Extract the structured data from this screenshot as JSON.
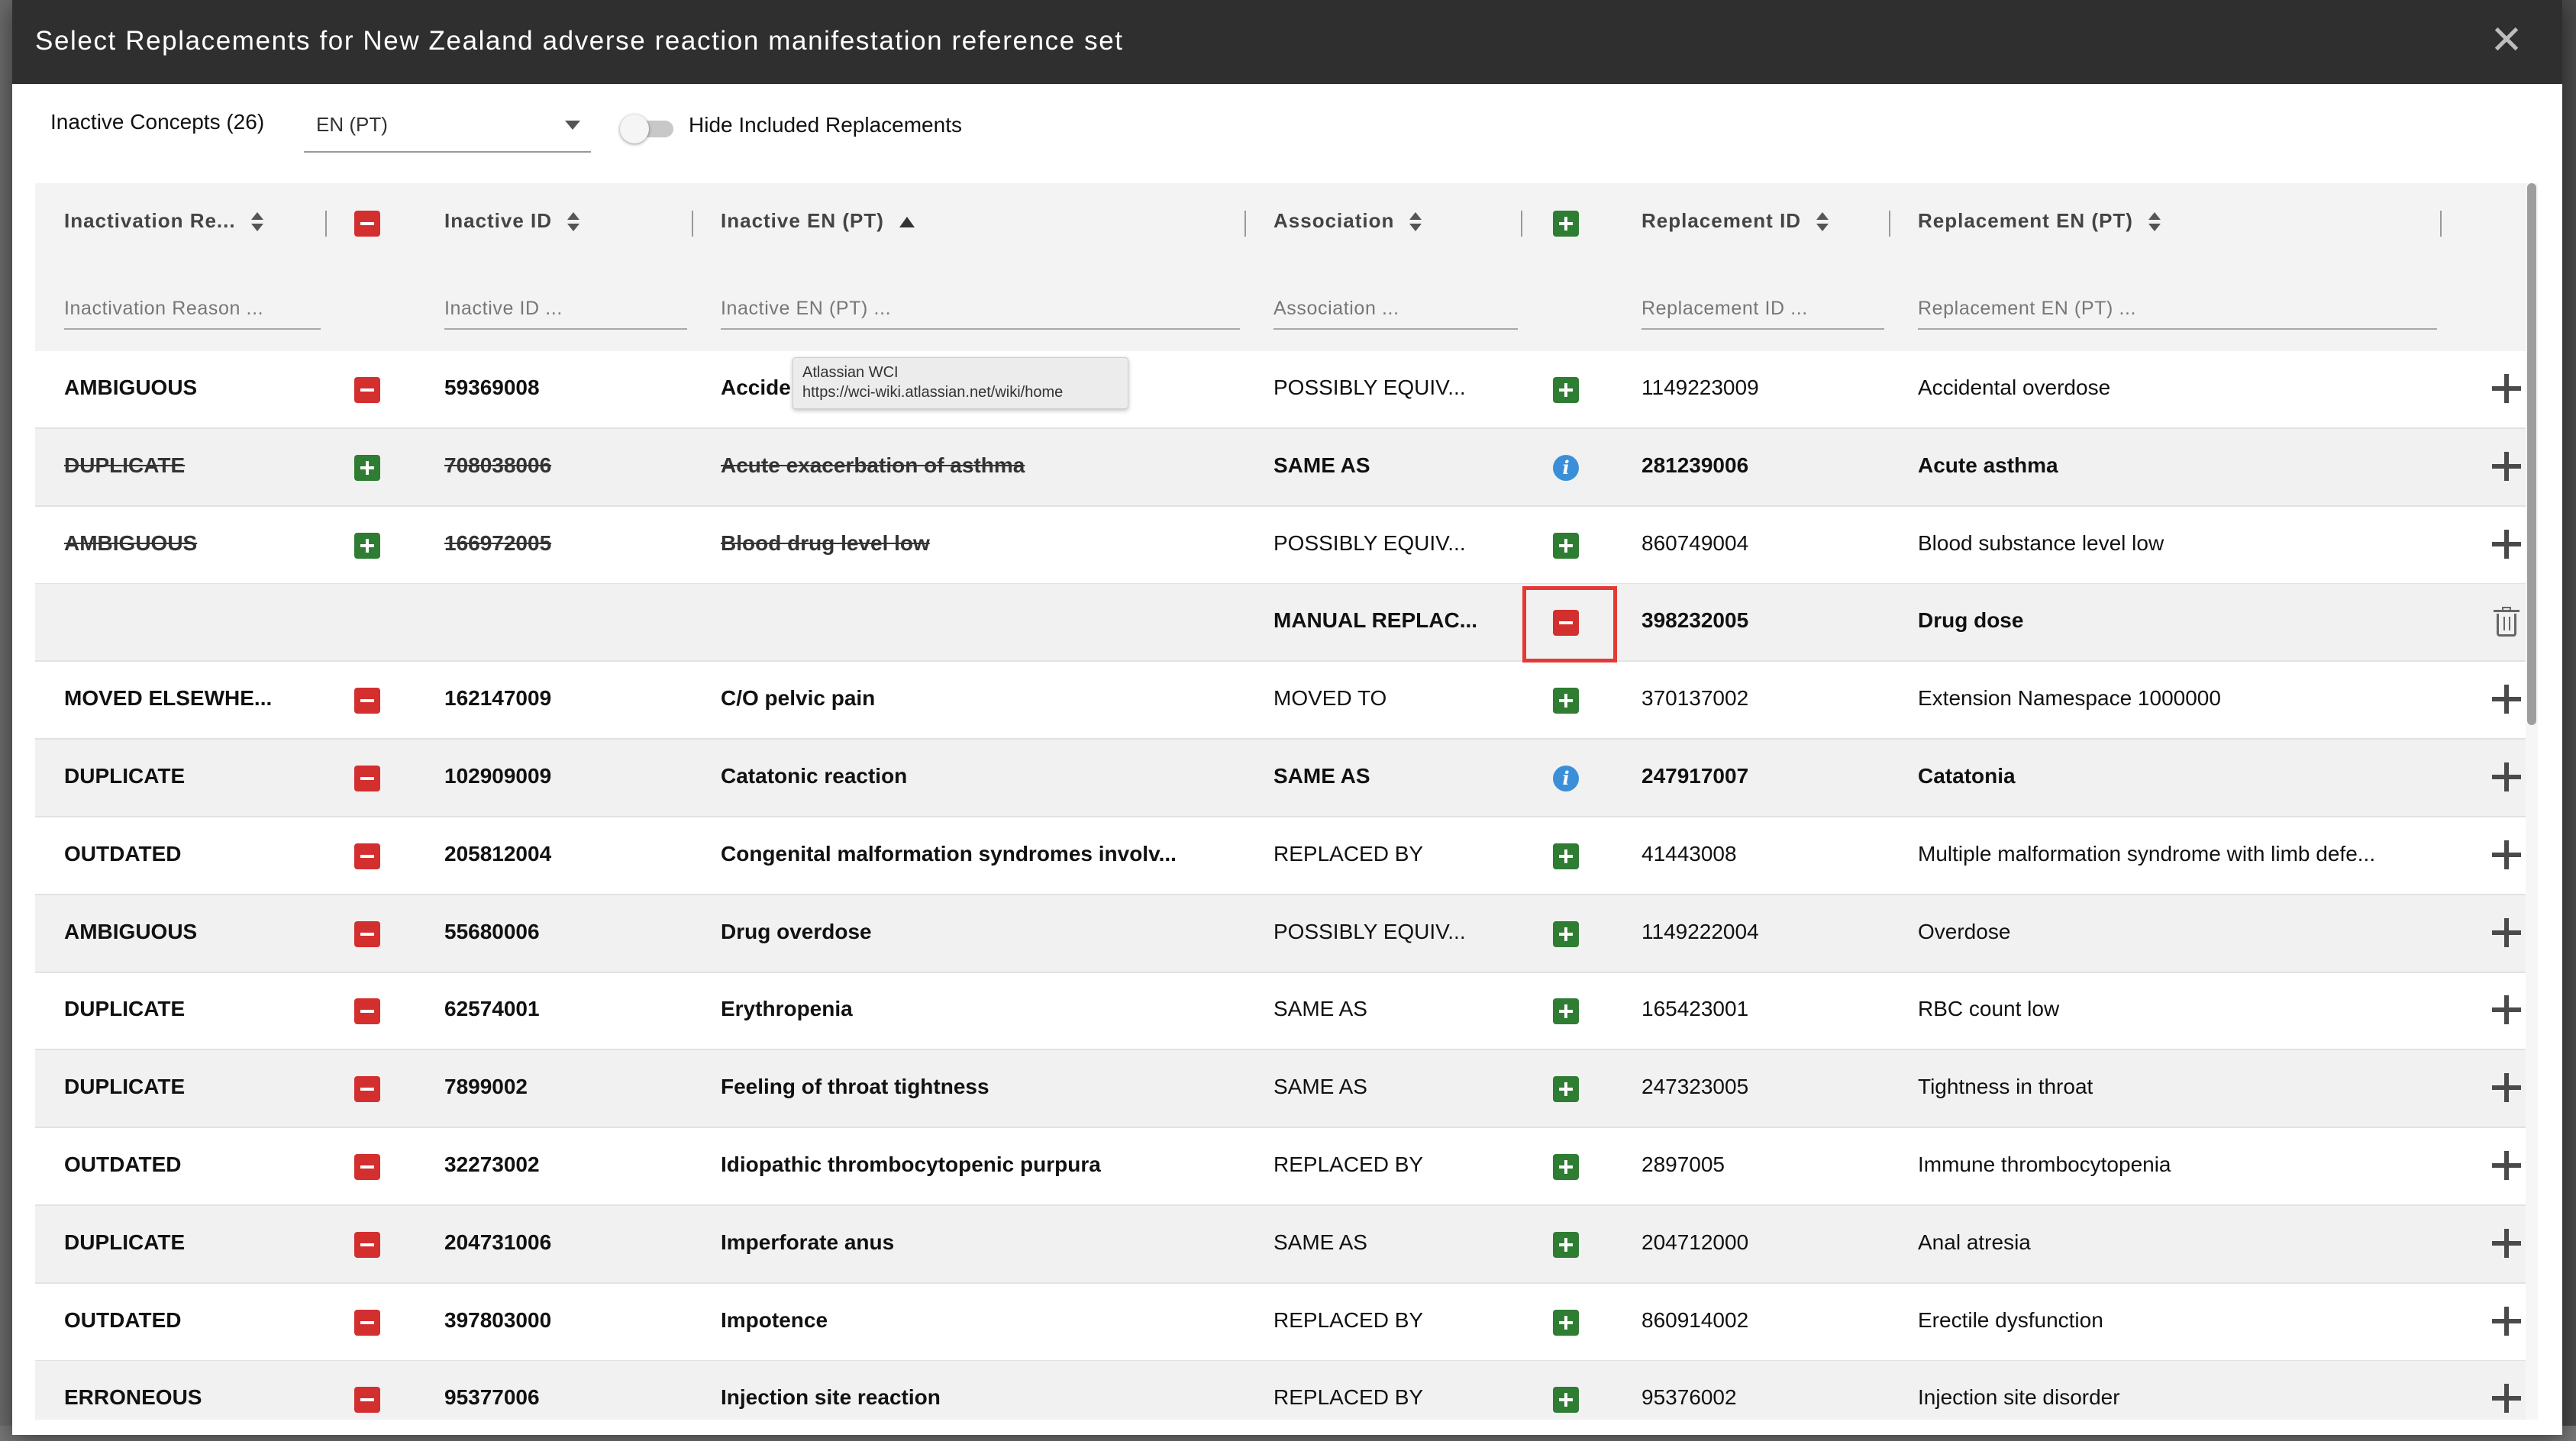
{
  "modal": {
    "title": "Select Replacements for New Zealand adverse reaction manifestation reference set",
    "close_glyph": "✕"
  },
  "toolbar": {
    "inactive_count": "Inactive Concepts (26)",
    "language": "EN (PT)",
    "toggle_label": "Hide Included Replacements",
    "toggle_on": false
  },
  "columns": {
    "reason": "Inactivation Re...",
    "inactive_id": "Inactive ID",
    "inactive_en": "Inactive EN (PT)",
    "association": "Association",
    "replacement_id": "Replacement ID",
    "replacement_en": "Replacement EN (PT)"
  },
  "filters": {
    "reason": "Inactivation Reason ...",
    "inactive_id": "Inactive ID ...",
    "inactive_en": "Inactive EN (PT) ...",
    "association": "Association ...",
    "replacement_id": "Replacement ID ...",
    "replacement_en": "Replacement EN (PT) ..."
  },
  "rows": [
    {
      "reason": "AMBIGUOUS",
      "inactive_id": "59369008",
      "inactive_en": "Accide",
      "association": "POSSIBLY EQUIV...",
      "replacement_id": "1149223009",
      "replacement_en": "Accidental overdose",
      "strike": false,
      "inc_icon": "minus-red",
      "assoc_bold": false,
      "assoc_icon": "plus-green",
      "repl_bold": false,
      "action": "add-icon"
    },
    {
      "reason": "DUPLICATE",
      "inactive_id": "708038006",
      "inactive_en": "Acute exacerbation of asthma",
      "association": "SAME AS",
      "replacement_id": "281239006",
      "replacement_en": "Acute asthma",
      "strike": true,
      "inc_icon": "plus-green",
      "assoc_bold": true,
      "assoc_icon": "info-blue",
      "repl_bold": true,
      "action": "add-icon"
    },
    {
      "reason": "AMBIGUOUS",
      "inactive_id": "166972005",
      "inactive_en": "Blood drug level low",
      "association": "POSSIBLY EQUIV...",
      "replacement_id": "860749004",
      "replacement_en": "Blood substance level low",
      "strike": true,
      "inc_icon": "plus-green",
      "assoc_bold": false,
      "assoc_icon": "plus-green",
      "repl_bold": false,
      "action": "add-icon"
    },
    {
      "reason": "",
      "inactive_id": "",
      "inactive_en": "",
      "association": "MANUAL REPLAC...",
      "replacement_id": "398232005",
      "replacement_en": "Drug dose",
      "strike": false,
      "inc_icon": "none",
      "assoc_bold": true,
      "assoc_icon": "minus-red",
      "repl_bold": true,
      "action": "trash-icon"
    },
    {
      "reason": "MOVED ELSEWHE...",
      "inactive_id": "162147009",
      "inactive_en": "C/O pelvic pain",
      "association": "MOVED TO",
      "replacement_id": "370137002",
      "replacement_en": "Extension Namespace 1000000",
      "strike": false,
      "inc_icon": "minus-red",
      "assoc_bold": false,
      "assoc_icon": "plus-green",
      "repl_bold": false,
      "action": "add-icon"
    },
    {
      "reason": "DUPLICATE",
      "inactive_id": "102909009",
      "inactive_en": "Catatonic reaction",
      "association": "SAME AS",
      "replacement_id": "247917007",
      "replacement_en": "Catatonia",
      "strike": false,
      "inc_icon": "minus-red",
      "assoc_bold": true,
      "assoc_icon": "info-blue",
      "repl_bold": true,
      "action": "add-icon"
    },
    {
      "reason": "OUTDATED",
      "inactive_id": "205812004",
      "inactive_en": "Congenital malformation syndromes involv...",
      "association": "REPLACED BY",
      "replacement_id": "41443008",
      "replacement_en": "Multiple malformation syndrome with limb defe...",
      "strike": false,
      "inc_icon": "minus-red",
      "assoc_bold": false,
      "assoc_icon": "plus-green",
      "repl_bold": false,
      "action": "add-icon"
    },
    {
      "reason": "AMBIGUOUS",
      "inactive_id": "55680006",
      "inactive_en": "Drug overdose",
      "association": "POSSIBLY EQUIV...",
      "replacement_id": "1149222004",
      "replacement_en": "Overdose",
      "strike": false,
      "inc_icon": "minus-red",
      "assoc_bold": false,
      "assoc_icon": "plus-green",
      "repl_bold": false,
      "action": "add-icon"
    },
    {
      "reason": "DUPLICATE",
      "inactive_id": "62574001",
      "inactive_en": "Erythropenia",
      "association": "SAME AS",
      "replacement_id": "165423001",
      "replacement_en": "RBC count low",
      "strike": false,
      "inc_icon": "minus-red",
      "assoc_bold": false,
      "assoc_icon": "plus-green",
      "repl_bold": false,
      "action": "add-icon"
    },
    {
      "reason": "DUPLICATE",
      "inactive_id": "7899002",
      "inactive_en": "Feeling of throat tightness",
      "association": "SAME AS",
      "replacement_id": "247323005",
      "replacement_en": "Tightness in throat",
      "strike": false,
      "inc_icon": "minus-red",
      "assoc_bold": false,
      "assoc_icon": "plus-green",
      "repl_bold": false,
      "action": "add-icon"
    },
    {
      "reason": "OUTDATED",
      "inactive_id": "32273002",
      "inactive_en": "Idiopathic thrombocytopenic purpura",
      "association": "REPLACED BY",
      "replacement_id": "2897005",
      "replacement_en": "Immune thrombocytopenia",
      "strike": false,
      "inc_icon": "minus-red",
      "assoc_bold": false,
      "assoc_icon": "plus-green",
      "repl_bold": false,
      "action": "add-icon"
    },
    {
      "reason": "DUPLICATE",
      "inactive_id": "204731006",
      "inactive_en": "Imperforate anus",
      "association": "SAME AS",
      "replacement_id": "204712000",
      "replacement_en": "Anal atresia",
      "strike": false,
      "inc_icon": "minus-red",
      "assoc_bold": false,
      "assoc_icon": "plus-green",
      "repl_bold": false,
      "action": "add-icon"
    },
    {
      "reason": "OUTDATED",
      "inactive_id": "397803000",
      "inactive_en": "Impotence",
      "association": "REPLACED BY",
      "replacement_id": "860914002",
      "replacement_en": "Erectile dysfunction",
      "strike": false,
      "inc_icon": "minus-red",
      "assoc_bold": false,
      "assoc_icon": "plus-green",
      "repl_bold": false,
      "action": "add-icon"
    },
    {
      "reason": "ERRONEOUS",
      "inactive_id": "95377006",
      "inactive_en": "Injection site reaction",
      "association": "REPLACED BY",
      "replacement_id": "95376002",
      "replacement_en": "Injection site disorder",
      "strike": false,
      "inc_icon": "minus-red",
      "assoc_bold": false,
      "assoc_icon": "plus-green",
      "repl_bold": false,
      "action": "add-icon"
    }
  ],
  "tooltip": {
    "line1": "Atlassian WCI",
    "line2": "https://wci-wiki.atlassian.net/wiki/home"
  },
  "colors": {
    "header_bg": "#2f2f2f",
    "remove_red": "#d32f2f",
    "add_green": "#2e7d32",
    "info_blue": "#3b8fd8",
    "highlight": "#e53935"
  }
}
